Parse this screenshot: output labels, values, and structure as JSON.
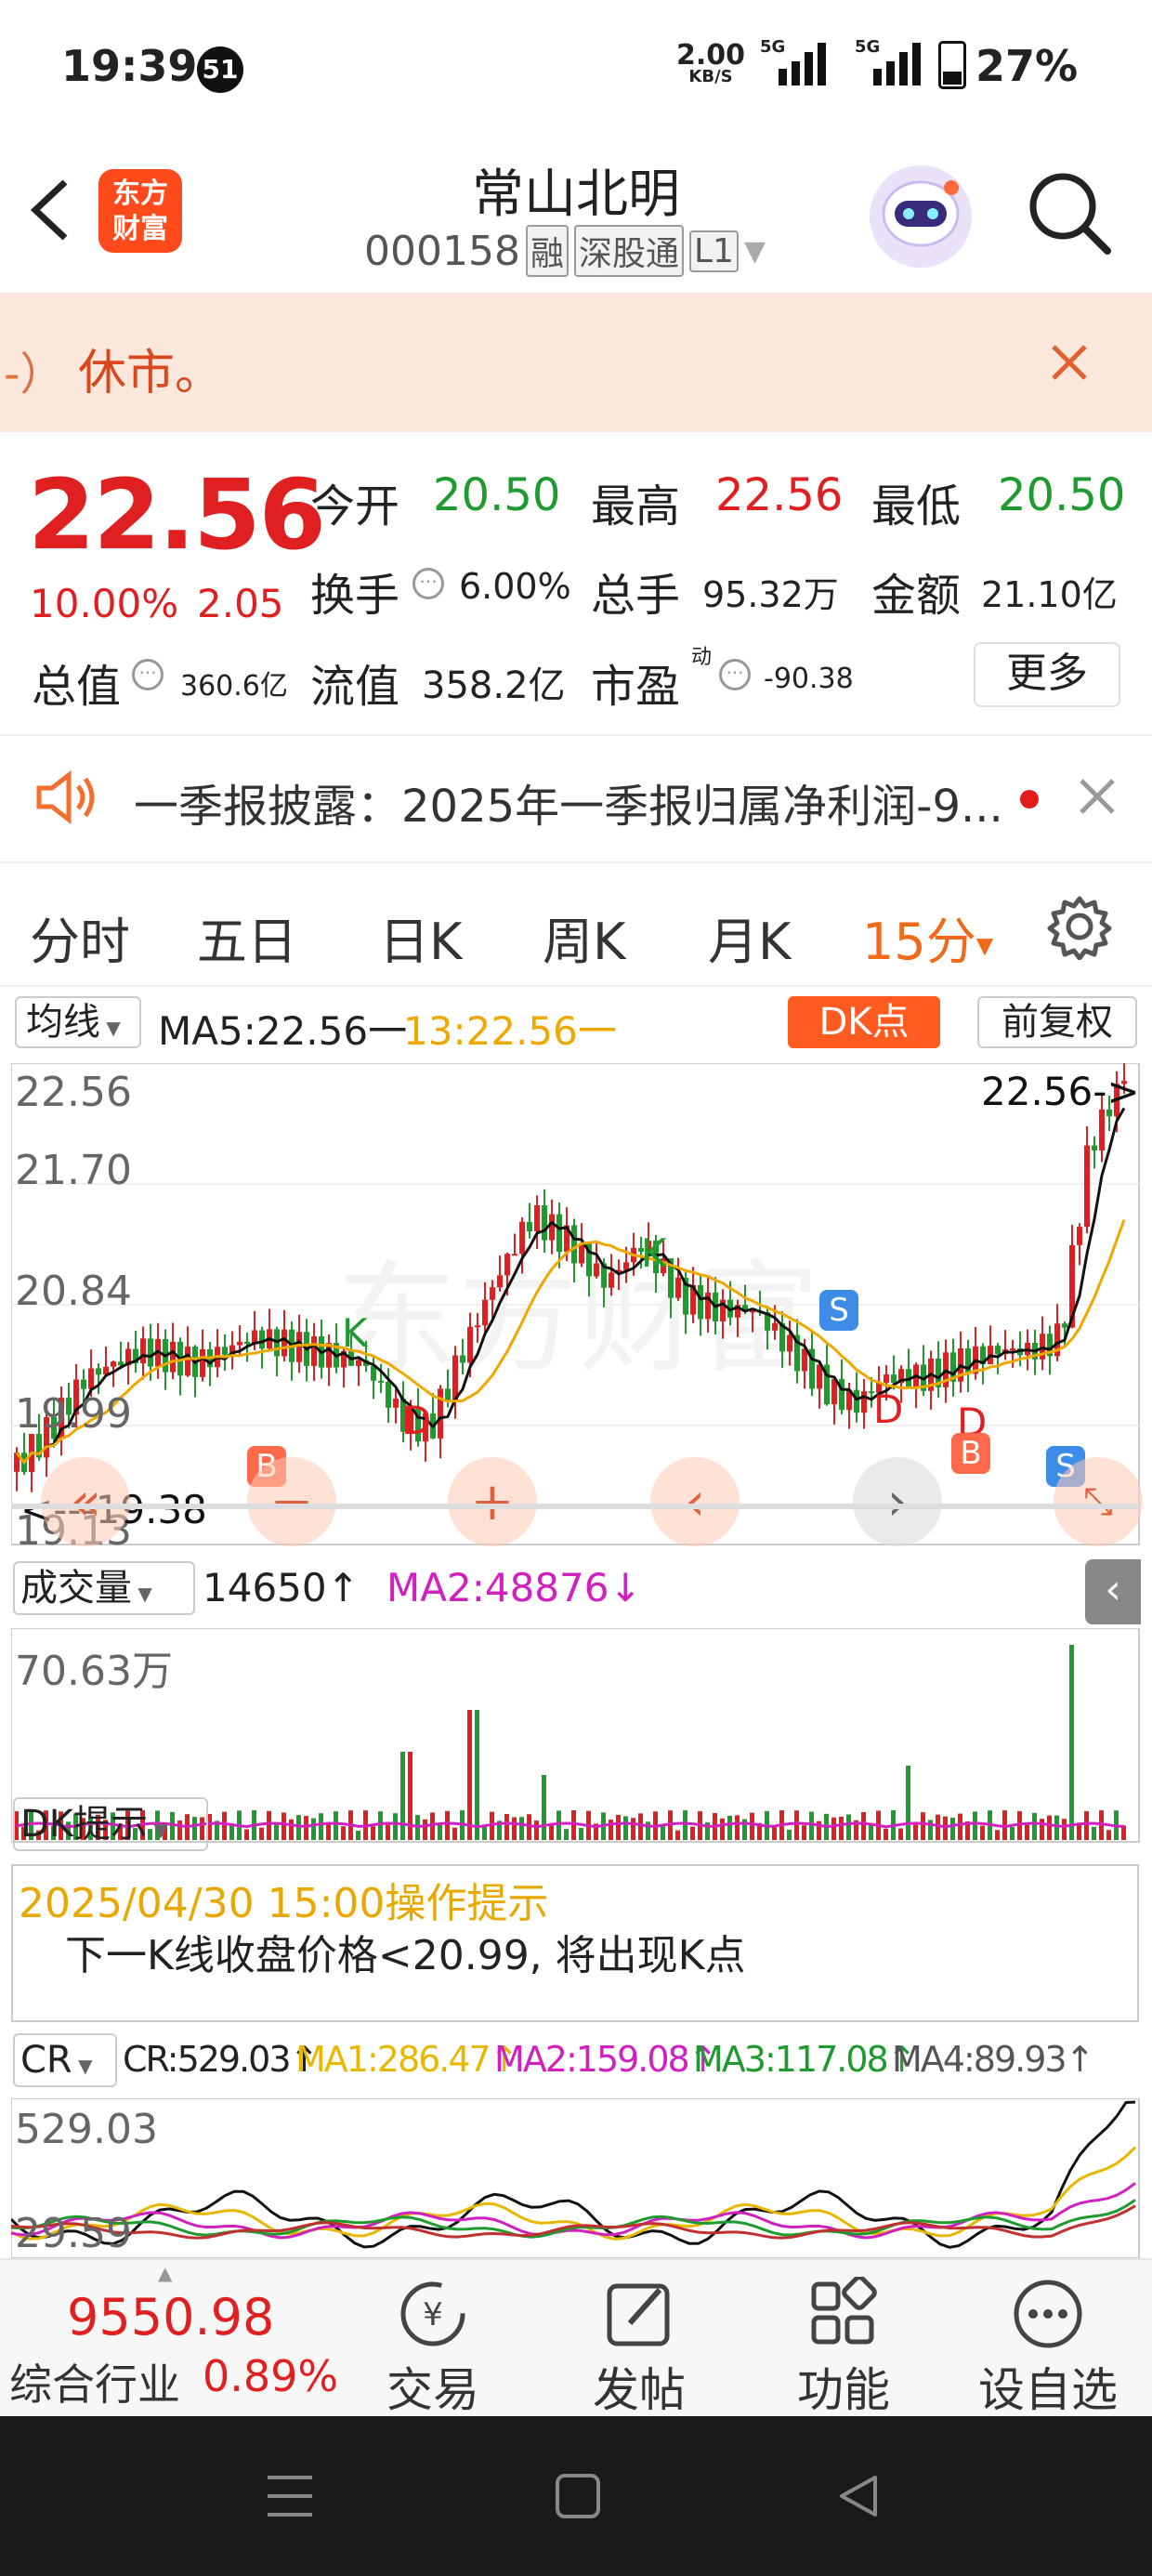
{
  "status": {
    "time": "19:39",
    "notif_count": "51",
    "speed_value": "2.00",
    "speed_unit": "KB/S",
    "net1": "5G",
    "net2": "5G",
    "battery": "27%"
  },
  "header": {
    "back_icon": "chevron-left-icon",
    "logo_text_1": "东方",
    "logo_text_2": "财富",
    "stock_name": "常山北明",
    "stock_code": "000158",
    "tag_margin": "融",
    "tag_connect": "深股通",
    "tag_level": "L1",
    "search_icon": "search-icon"
  },
  "notice": {
    "prefix": "-）",
    "text": "休市。",
    "close_icon": "close-icon"
  },
  "quote": {
    "price": "22.56",
    "change_pct": "10.00%",
    "change_amt": "2.05",
    "open_label": "今开",
    "open": "20.50",
    "high_label": "最高",
    "high": "22.56",
    "low_label": "最低",
    "low": "20.50",
    "turnover_label": "换手",
    "turnover": "6.00%",
    "volume_label": "总手",
    "volume": "95.32万",
    "amount_label": "金额",
    "amount": "21.10亿",
    "mktcap_label": "总值",
    "mktcap": "360.6亿",
    "float_label": "流值",
    "float_cap": "358.2亿",
    "pe_label": "市盈",
    "pe_sup": "动",
    "pe": "-90.38",
    "more_label": "更多"
  },
  "announce": {
    "text": "一季报披露：2025年一季报归属净利润-9...",
    "close_icon": "close-icon"
  },
  "tabs": {
    "items": [
      "分时",
      "五日",
      "日K",
      "周K",
      "月K"
    ],
    "active": "15分",
    "active_arrow": "▼",
    "settings_icon": "gear-icon"
  },
  "kline": {
    "ma_selector": "均线",
    "ma5": "MA5:22.56一",
    "ma13": "13:22.56一",
    "dk_button": "DK点",
    "adjust_button": "前复权",
    "price_top": "22.56",
    "price_2": "21.70",
    "price_3": "20.84",
    "price_4": "19.99",
    "price_low": "19.13",
    "high_marker": "22.56->",
    "low_marker": "<---19.38",
    "watermark": "东方财富",
    "signals": {
      "k": "K",
      "d": "D",
      "b": "B",
      "s": "S"
    }
  },
  "volume": {
    "selector": "成交量",
    "value": "14650↑",
    "ma2": "MA2:48876↓",
    "top_label": "70.63万"
  },
  "dk": {
    "selector": "DK提示",
    "datetime": "2025/04/30 15:00操作提示",
    "message": "下一K线收盘价格<20.99, 将出现K点"
  },
  "cr": {
    "selector": "CR",
    "cr": "CR:529.03↑",
    "ma1": "MA1:286.47↑",
    "ma2": "MA2:159.08↑",
    "ma3": "MA3:117.08↑",
    "ma4": "MA4:89.93↑",
    "top_label": "529.03",
    "bottom_label": "29.59"
  },
  "bottom": {
    "index_value": "9550.98",
    "index_label": "综合行业",
    "index_change": "0.89%",
    "trade": "交易",
    "post": "发帖",
    "func": "功能",
    "watchlist": "设自选"
  },
  "colors": {
    "up": "#e02020",
    "down": "#1f9a2f",
    "ma5": "#111111",
    "ma13": "#f0a800",
    "accent": "#ff5a1f",
    "notice_bg": "#fbe7dc"
  }
}
